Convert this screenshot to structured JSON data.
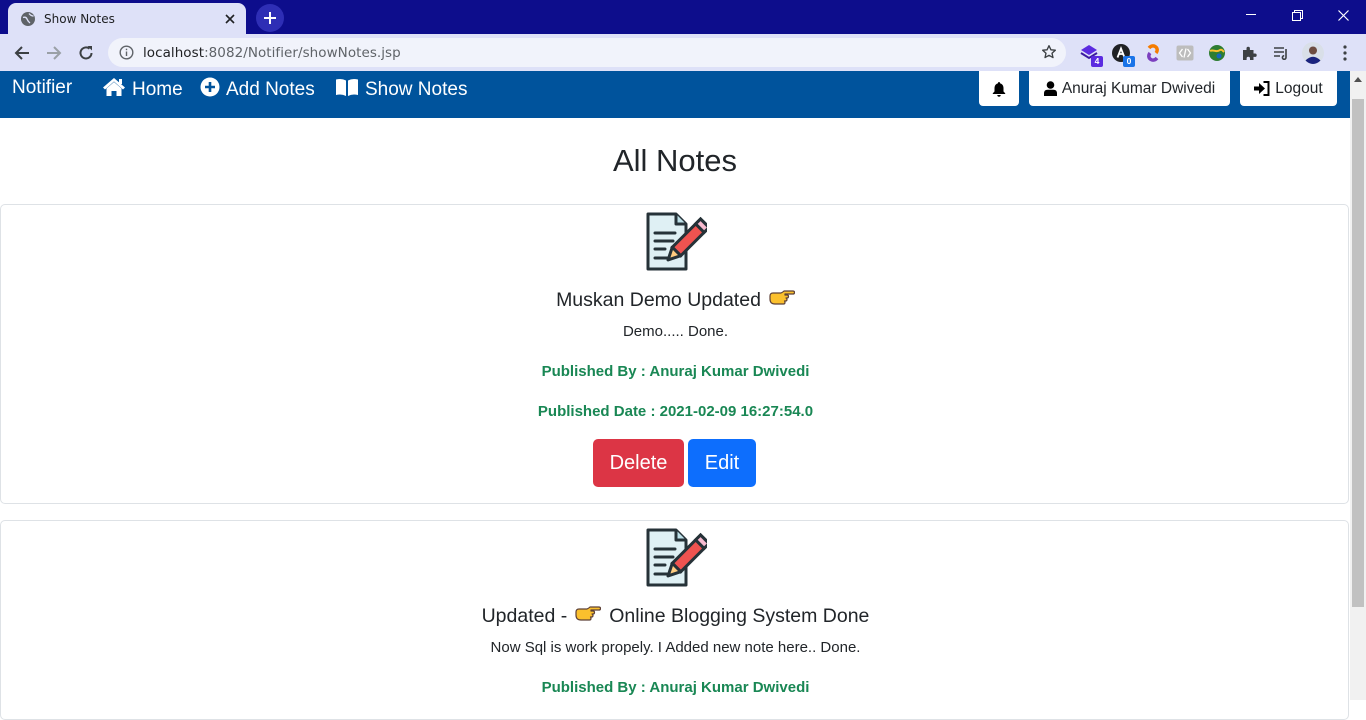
{
  "browser": {
    "tab_title": "Show Notes",
    "url_host": "localhost",
    "url_rest": ":8082/Notifier/showNotes.jsp",
    "extensions": [
      {
        "icon": "purple-stack-extension-icon",
        "badge": "4",
        "badge_color": "#5b2be0"
      },
      {
        "icon": "dark-a-extension-icon",
        "badge": "0",
        "badge_color": "#1a73e8"
      }
    ]
  },
  "navbar": {
    "brand": "Notifier",
    "links": [
      {
        "label": "Home",
        "icon": "home-icon"
      },
      {
        "label": "Add Notes",
        "icon": "plus-circle-icon"
      },
      {
        "label": "Show Notes",
        "icon": "book-open-icon"
      }
    ],
    "user_name": "Anuraj Kumar Dwivedi",
    "logout_label": "Logout",
    "color": "#00539c"
  },
  "page": {
    "title": "All Notes"
  },
  "notes": [
    {
      "title_before": "Muskan Demo Updated",
      "title_after": "",
      "content": "Demo..... Done.",
      "published_by": "Published By : Anuraj Kumar Dwivedi",
      "published_date": "Published Date : 2021-02-09 16:27:54.0",
      "delete_label": "Delete",
      "edit_label": "Edit"
    },
    {
      "title_before": "Updated -",
      "title_after": "Online Blogging System Done",
      "content": "Now Sql is work propely. I Added new note here.. Done.",
      "published_by": "Published By : Anuraj Kumar Dwivedi"
    }
  ],
  "colors": {
    "delete": "#dc3545",
    "edit": "#0d6efd",
    "meta_text": "#198754"
  }
}
